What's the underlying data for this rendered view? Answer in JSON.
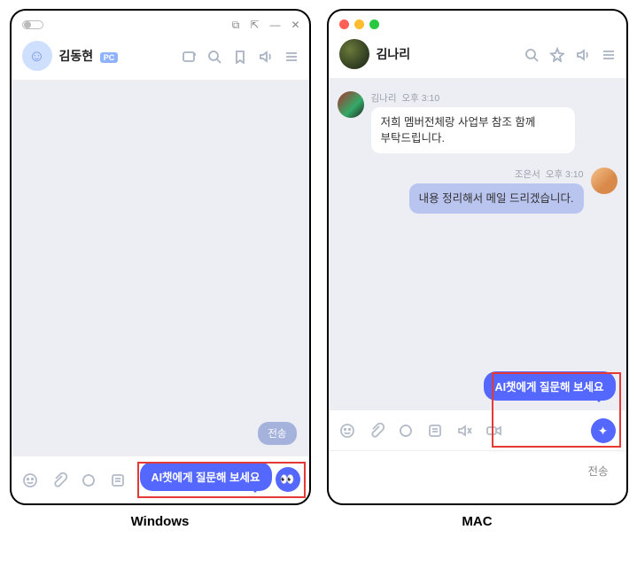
{
  "captions": {
    "windows": "Windows",
    "mac": "MAC"
  },
  "windows": {
    "user": "김동현",
    "pc_badge": "PC",
    "send_label": "전송",
    "ai_tooltip": "AI챗에게 질문해 보세요"
  },
  "mac": {
    "user": "김나리",
    "messages": [
      {
        "sender": "김나리",
        "time": "오후 3:10",
        "text": "저희 멤버전체랑 사업부 참조 함께 부탁드립니다."
      },
      {
        "sender": "조은서",
        "time": "오후 3:10",
        "text": "내용 정리해서 메일 드리겠습니다."
      }
    ],
    "send_label": "전송",
    "ai_tooltip": "AI챗에게 질문해 보세요"
  }
}
